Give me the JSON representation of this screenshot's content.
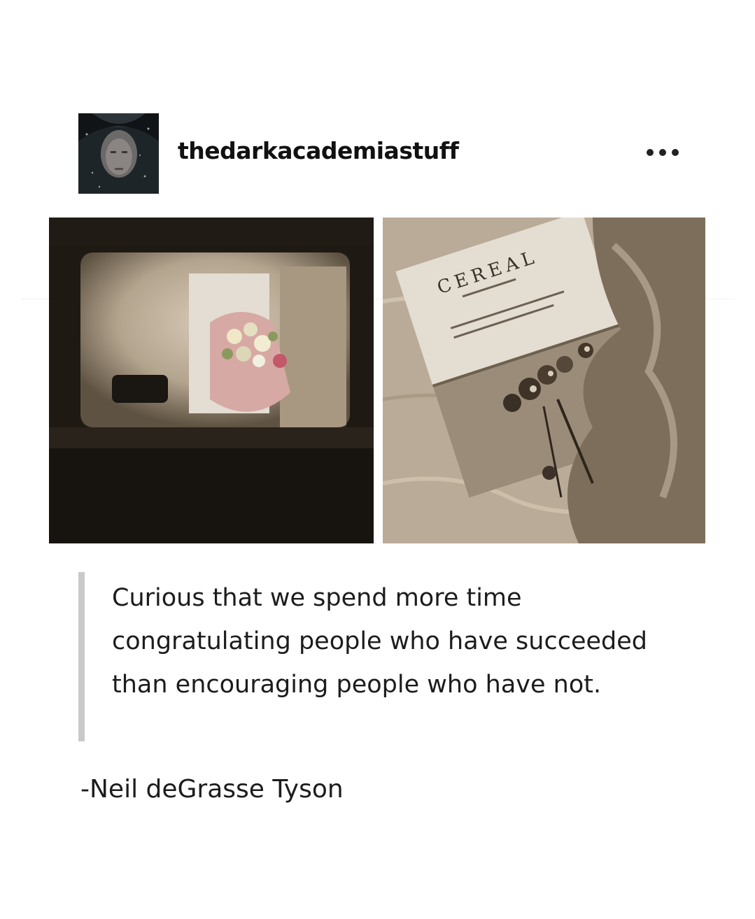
{
  "post": {
    "username": "thedarkacademiastuff",
    "more_icon": "ellipsis-icon",
    "photos": [
      {
        "name": "flowers-bouquet-photo"
      },
      {
        "name": "cereal-magazine-photo",
        "visible_text": "CEREAL"
      }
    ],
    "quote": "Curious that we spend more time congratulating people who have succeeded than encouraging people who have not.",
    "attribution": "-Neil deGrasse Tyson"
  },
  "colors": {
    "background": "#ffffff",
    "text": "#1c1c1c",
    "quote_bar": "#c9c9c9",
    "sepia_light": "#cbbca6",
    "sepia_dark": "#2a2118"
  }
}
